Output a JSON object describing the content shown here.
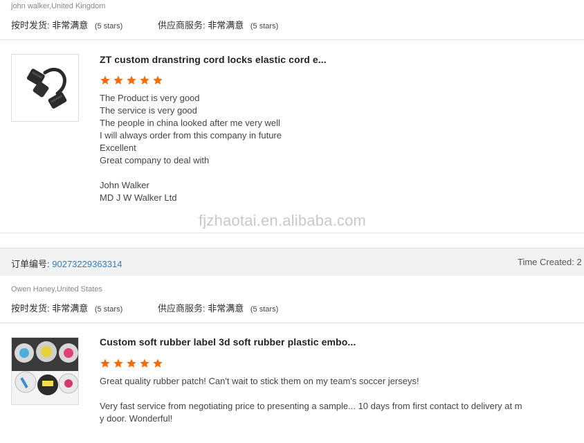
{
  "reviews": [
    {
      "buyer": "john walker,United Kingdom",
      "delivery_label": "按时发货:",
      "delivery_value": "非常满意",
      "delivery_stars": "(5 stars)",
      "service_label": "供应商服务:",
      "service_value": "非常满意",
      "service_stars": "(5 stars)",
      "product_title": "ZT custom dranstring cord locks elastic cord e...",
      "rating": 5,
      "review_lines": [
        "The Product is very good",
        "The service is very good",
        "The people in china looked after me very well",
        "I will always order from this company in future",
        "Excellent",
        "Great company to deal with",
        "",
        "John Walker",
        "MD J W Walker Ltd"
      ]
    },
    {
      "order_label": "订单编号:",
      "order_number": "90273229363314",
      "time_created_label": "Time Created: 2",
      "buyer": "Owen Haney,United States",
      "delivery_label": "按时发货:",
      "delivery_value": "非常满意",
      "delivery_stars": "(5 stars)",
      "service_label": "供应商服务:",
      "service_value": "非常满意",
      "service_stars": "(5 stars)",
      "product_title": "Custom soft rubber label 3d soft rubber plastic embo...",
      "rating": 5,
      "review_lines": [
        "Great quality rubber patch! Can't wait to stick them on my team's soccer jerseys!",
        "",
        "Very fast service from negotiating price to presenting a sample... 10 days from first contact to delivery at m",
        "y door. Wonderful!"
      ]
    }
  ],
  "watermark": "fjzhaotai.en.alibaba.com",
  "star_color": "#ff6a00"
}
